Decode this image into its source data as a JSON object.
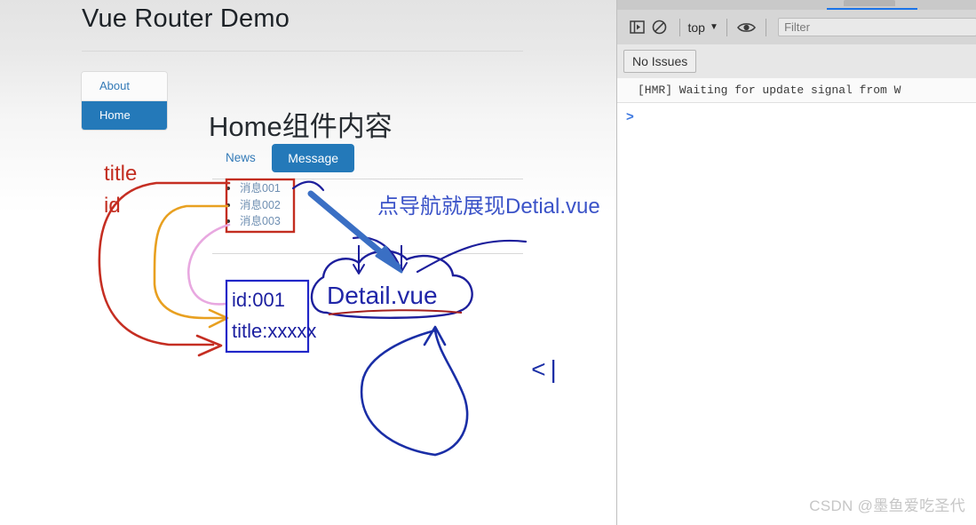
{
  "page": {
    "title": "Vue Router Demo",
    "nav": {
      "items": [
        {
          "label": "About",
          "active": false
        },
        {
          "label": "Home",
          "active": true
        }
      ]
    },
    "heading": "Home组件内容",
    "tabs": [
      {
        "label": "News",
        "active": false
      },
      {
        "label": "Message",
        "active": true
      }
    ],
    "messages": [
      {
        "label": "消息001"
      },
      {
        "label": "消息002"
      },
      {
        "label": "消息003"
      }
    ],
    "link_color": "#6f8fb2",
    "active_color": "#2479b9"
  },
  "annotations": {
    "title_label": "title",
    "id_label": "id",
    "blue_note": "点导航就展现Detial.vue",
    "detail_label": "Detail.vue",
    "idbox_line1": "id:001",
    "idbox_line2": "title:xxxxx",
    "caret": "<|",
    "red_color": "#c32d20",
    "orange_color": "#e8a020",
    "pink_color": "#e8a8e0",
    "blue_color": "#2026a8",
    "arrow_blue": "#3a6fc4"
  },
  "devtools": {
    "toolbar": {
      "sidebar_toggle": "sidebar-toggle-icon",
      "clear_console": "clear-console-icon",
      "context_select": "top",
      "chevron": "▼",
      "eye": "eye-icon",
      "filter_placeholder": "Filter"
    },
    "issues_button": "No Issues",
    "console_message": "[HMR] Waiting for update signal from W",
    "prompt": ">"
  },
  "watermark": "CSDN @墨鱼爱吃圣代"
}
